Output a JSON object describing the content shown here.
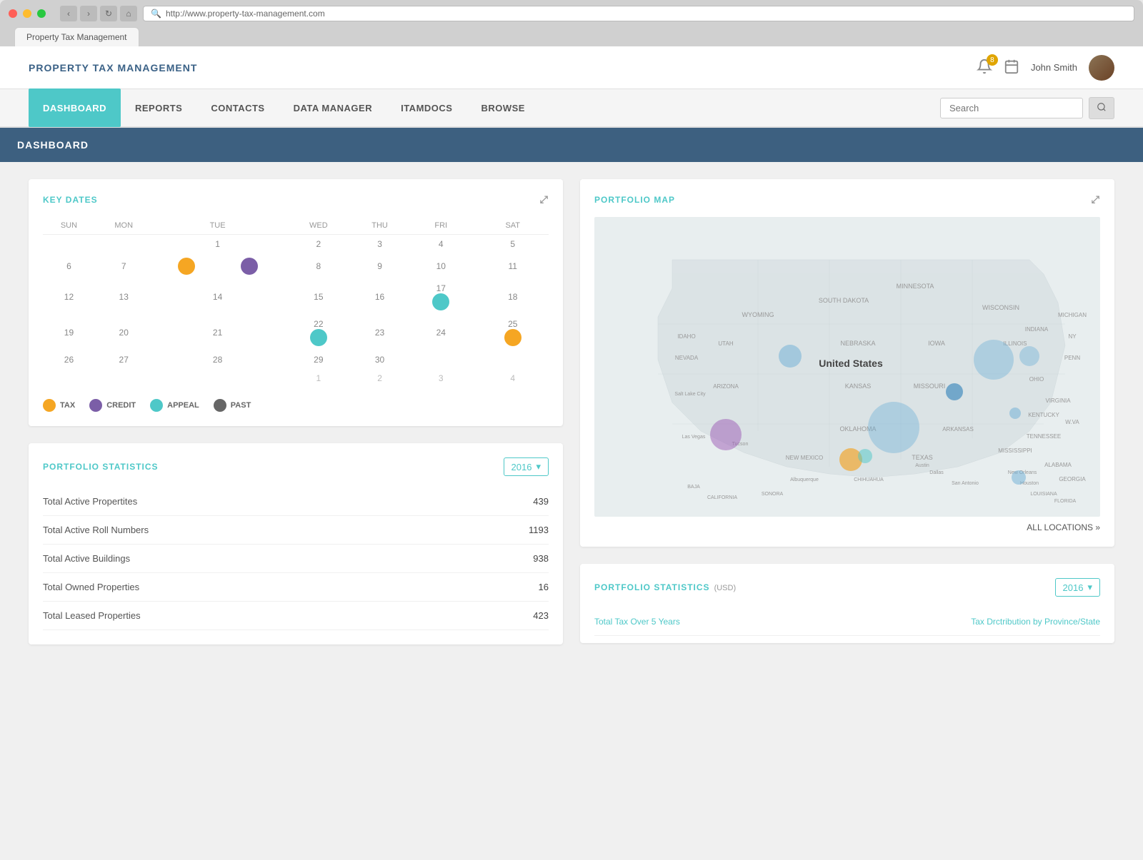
{
  "browser": {
    "url": "http://www.property-tax-management.com",
    "tab_label": "Property Tax Management"
  },
  "header": {
    "brand": "PROPERTY TAX MANAGEMENT",
    "notification_count": "8",
    "user_name": "John Smith"
  },
  "nav": {
    "items": [
      {
        "id": "dashboard",
        "label": "DASHBOARD",
        "active": true
      },
      {
        "id": "reports",
        "label": "REPORTS",
        "active": false
      },
      {
        "id": "contacts",
        "label": "CONTACTS",
        "active": false
      },
      {
        "id": "data-manager",
        "label": "DATA MANAGER",
        "active": false
      },
      {
        "id": "itamdocs",
        "label": "ITAMDOCS",
        "active": false
      },
      {
        "id": "browse",
        "label": "BROWSE",
        "active": false
      }
    ],
    "search_placeholder": "Search"
  },
  "page_title": "DASHBOARD",
  "key_dates": {
    "title": "KEY DATES",
    "days": [
      "SUN",
      "MON",
      "TUE",
      "WED",
      "THU",
      "FRI",
      "SAT"
    ],
    "legend": [
      {
        "type": "tax",
        "label": "TAX",
        "color": "#f5a623"
      },
      {
        "type": "credit",
        "label": "CREDIT",
        "color": "#7b5ea7"
      },
      {
        "type": "appeal",
        "label": "APPEAL",
        "color": "#4ec8c8"
      },
      {
        "type": "past",
        "label": "PAST",
        "color": "#666666"
      }
    ]
  },
  "portfolio_stats_left": {
    "title": "PORTFOLIO STATISTICS",
    "year": "2016",
    "rows": [
      {
        "label": "Total Active Propertites",
        "value": "439"
      },
      {
        "label": "Total Active Roll Numbers",
        "value": "1193"
      },
      {
        "label": "Total Active Buildings",
        "value": "938"
      },
      {
        "label": "Total Owned Properties",
        "value": "16"
      },
      {
        "label": "Total Leased Properties",
        "value": "423"
      }
    ]
  },
  "portfolio_map": {
    "title": "PORTFOLIO MAP",
    "all_locations": "ALL LOCATIONS »"
  },
  "portfolio_stats_right": {
    "title": "PORTFOLIO STATISTICS",
    "subtitle": "(USD)",
    "year": "2016",
    "row1": "Total Tax Over 5 Years",
    "row2": "Tax Drctribution by Province/State"
  }
}
